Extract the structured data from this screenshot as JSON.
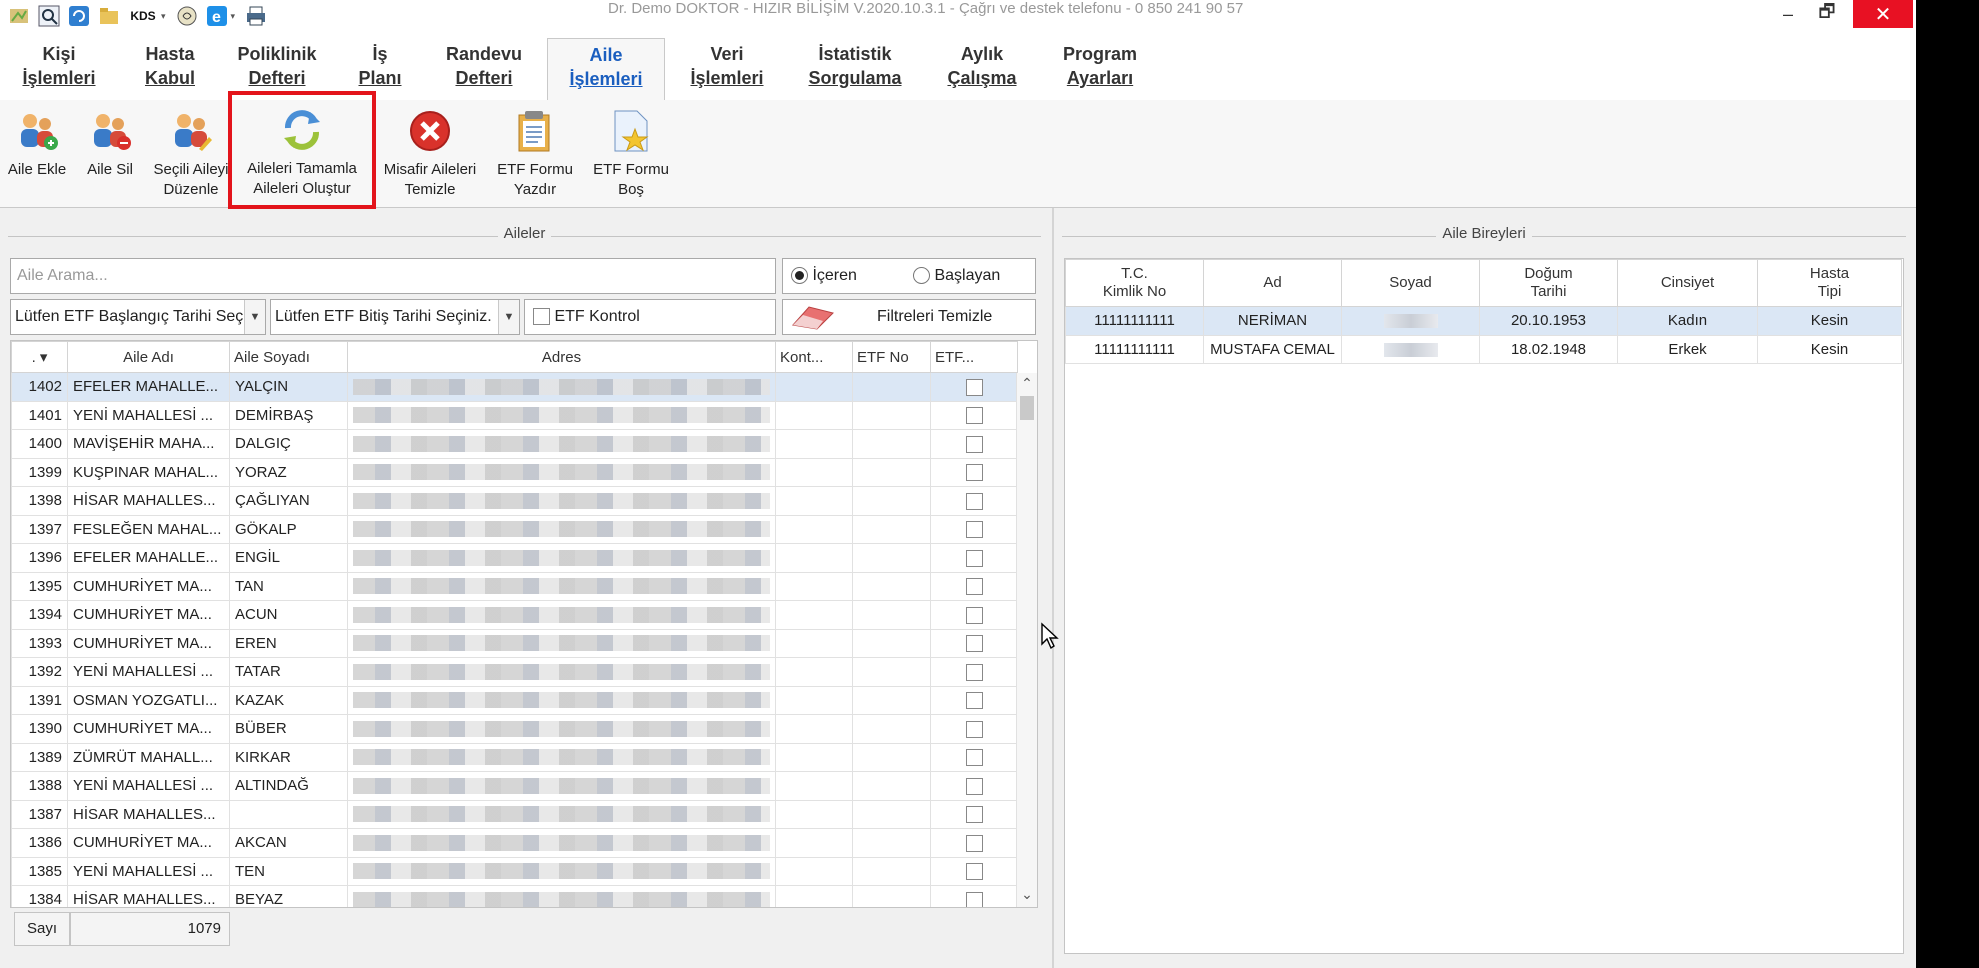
{
  "window": {
    "title": "Dr. Demo DOKTOR - HIZIR BİLİŞİM V.2020.10.3.1 - Çağrı ve destek telefonu - 0 850 241 90 57",
    "minimize": "‒",
    "restore": "🗗",
    "close": "✕"
  },
  "qat": {
    "kds_label": "KDS",
    "drop": "▾"
  },
  "tabs": [
    {
      "l1": "Kişi",
      "l2": "İşlemleri"
    },
    {
      "l1": "Hasta",
      "l2": "Kabul"
    },
    {
      "l1": "Poliklinik",
      "l2": "Defteri"
    },
    {
      "l1": "İş",
      "l2": "Planı"
    },
    {
      "l1": "Randevu",
      "l2": "Defteri"
    },
    {
      "l1": "Aile",
      "l2": "İşlemleri"
    },
    {
      "l1": "Veri",
      "l2": "İşlemleri"
    },
    {
      "l1": "İstatistik",
      "l2": "Sorgulama"
    },
    {
      "l1": "Aylık",
      "l2": "Çalışma"
    },
    {
      "l1": "Program",
      "l2": "Ayarları"
    }
  ],
  "ribbon": [
    {
      "l1": "Aile Ekle",
      "l2": ""
    },
    {
      "l1": "Aile Sil",
      "l2": ""
    },
    {
      "l1": "Seçili Aileyi",
      "l2": "Düzenle"
    },
    {
      "l1": "Aileleri Tamamla",
      "l2": "Aileleri Oluştur"
    },
    {
      "l1": "Misafir Aileleri",
      "l2": "Temizle"
    },
    {
      "l1": "ETF Formu",
      "l2": "Yazdır"
    },
    {
      "l1": "ETF Formu",
      "l2": "Boş"
    }
  ],
  "left": {
    "title": "Aileler",
    "search_placeholder": "Aile Arama...",
    "radio_contains": "İçeren",
    "radio_starts": "Başlayan",
    "etf_start": "Lütfen ETF Başlangıç Tarihi Seç",
    "etf_end": "Lütfen ETF Bitiş Tarihi Seçiniz.",
    "etf_control": "ETF Kontrol",
    "clear_filters": "Filtreleri Temizle",
    "columns": [
      ". ▾",
      "Aile Adı",
      "Aile Soyadı",
      "Adres",
      "Kont...",
      "ETF No",
      "ETF..."
    ],
    "rows": [
      {
        "id": "1402",
        "name": "EFELER MAHALLE...",
        "surname": "YALÇIN"
      },
      {
        "id": "1401",
        "name": "YENİ MAHALLESİ ...",
        "surname": "DEMİRBAŞ"
      },
      {
        "id": "1400",
        "name": "MAVİŞEHİR MAHA...",
        "surname": "DALGIÇ"
      },
      {
        "id": "1399",
        "name": "KUŞPINAR MAHAL...",
        "surname": "YORAZ"
      },
      {
        "id": "1398",
        "name": "HİSAR MAHALLES...",
        "surname": "ÇAĞLIYAN"
      },
      {
        "id": "1397",
        "name": "FESLEĞEN MAHAL...",
        "surname": "GÖKALP"
      },
      {
        "id": "1396",
        "name": "EFELER MAHALLE...",
        "surname": "ENGİL"
      },
      {
        "id": "1395",
        "name": "CUMHURİYET MA...",
        "surname": "TAN"
      },
      {
        "id": "1394",
        "name": "CUMHURİYET MA...",
        "surname": "ACUN"
      },
      {
        "id": "1393",
        "name": "CUMHURİYET MA...",
        "surname": "EREN"
      },
      {
        "id": "1392",
        "name": "YENİ MAHALLESİ ...",
        "surname": "TATAR"
      },
      {
        "id": "1391",
        "name": "OSMAN YOZGATLI...",
        "surname": "KAZAK"
      },
      {
        "id": "1390",
        "name": "CUMHURİYET MA...",
        "surname": "BÜBER"
      },
      {
        "id": "1389",
        "name": "ZÜMRÜT MAHALL...",
        "surname": "KIRKAR"
      },
      {
        "id": "1388",
        "name": "YENİ MAHALLESİ ...",
        "surname": "ALTINDAĞ"
      },
      {
        "id": "1387",
        "name": "HİSAR MAHALLES...",
        "surname": ""
      },
      {
        "id": "1386",
        "name": "CUMHURİYET MA...",
        "surname": "AKCAN"
      },
      {
        "id": "1385",
        "name": "YENİ MAHALLESİ ...",
        "surname": "TEN"
      },
      {
        "id": "1384",
        "name": "HİSAR MAHALLES...",
        "surname": "BEYAZ"
      }
    ],
    "footer_label": "Sayı",
    "footer_count": "1079"
  },
  "right": {
    "title": "Aile Bireyleri",
    "columns": [
      {
        "l1": "T.C.",
        "l2": "Kimlik No"
      },
      {
        "l1": "Ad",
        "l2": ""
      },
      {
        "l1": "Soyad",
        "l2": ""
      },
      {
        "l1": "Doğum",
        "l2": "Tarihi"
      },
      {
        "l1": "Cinsiyet",
        "l2": ""
      },
      {
        "l1": "Hasta",
        "l2": "Tipi"
      }
    ],
    "rows": [
      {
        "tc": "11111111111",
        "ad": "NERİMAN",
        "dogum": "20.10.1953",
        "cinsiyet": "Kadın",
        "tip": "Kesin"
      },
      {
        "tc": "11111111111",
        "ad": "MUSTAFA CEMAL",
        "dogum": "18.02.1948",
        "cinsiyet": "Erkek",
        "tip": "Kesin"
      }
    ]
  },
  "colors": {
    "accent": "#1a5ebf",
    "highlight": "#e3141b",
    "selection": "#dbe7f5",
    "close": "#e81123"
  }
}
